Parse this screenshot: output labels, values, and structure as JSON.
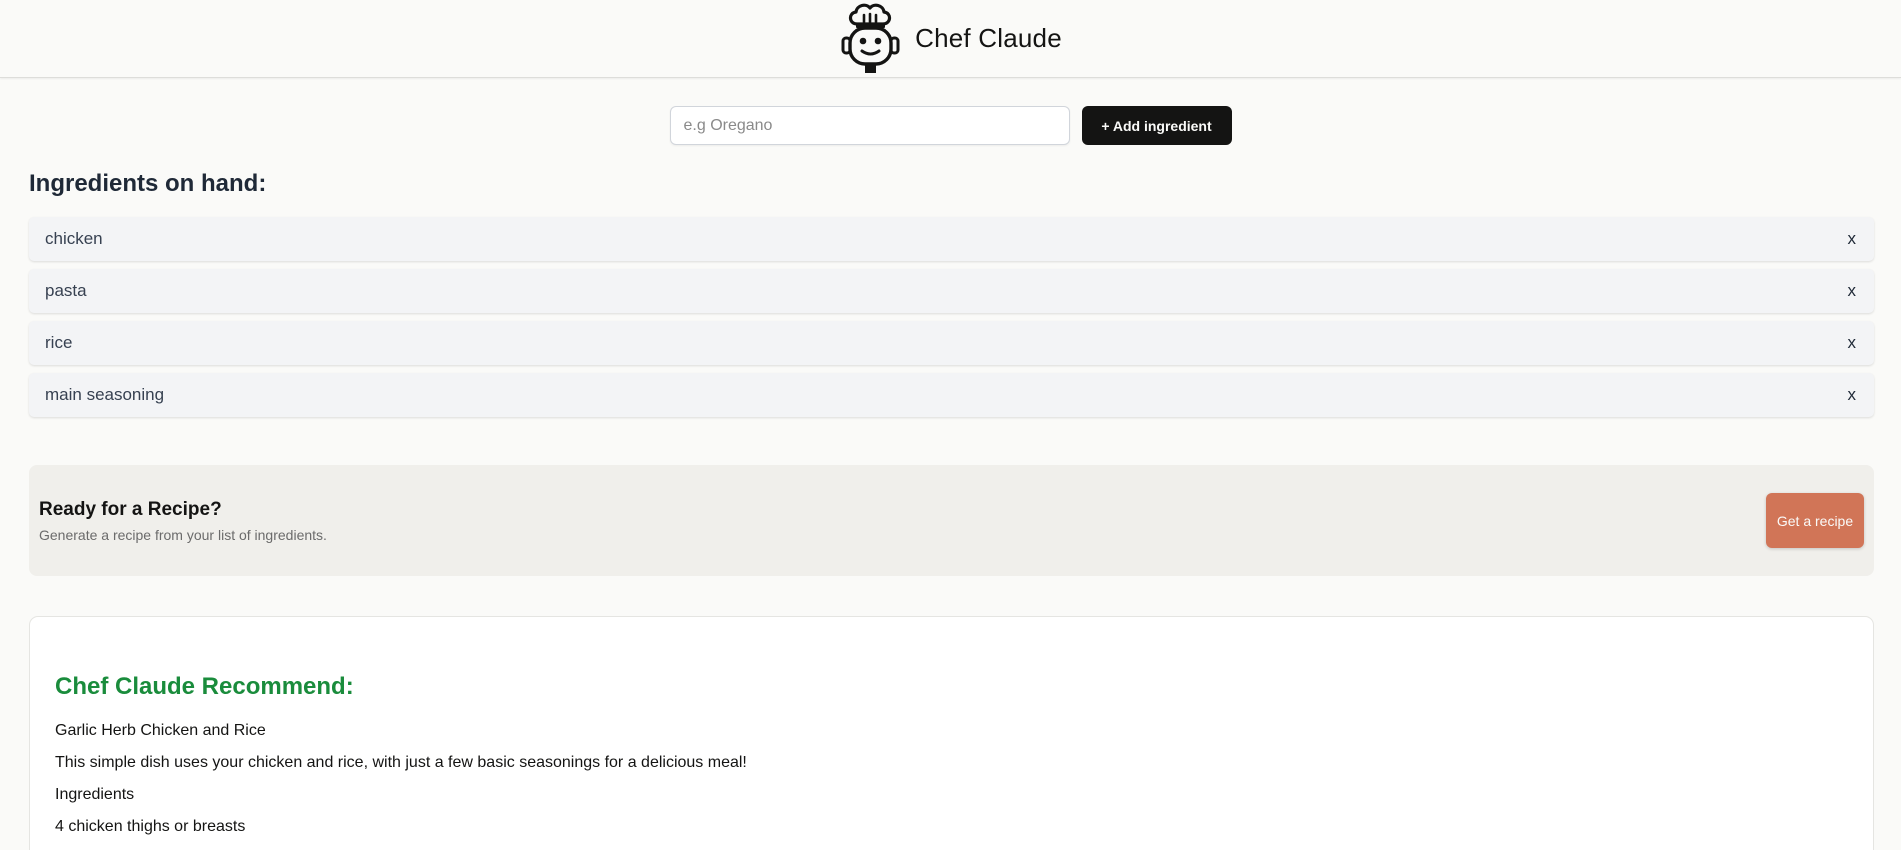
{
  "header": {
    "title": "Chef Claude",
    "logo_icon": "chef-robot-icon"
  },
  "add_form": {
    "placeholder": "e.g Oregano",
    "button_label": "+ Add ingredient"
  },
  "ingredients": {
    "heading": "Ingredients on hand:",
    "items": [
      {
        "name": "chicken",
        "remove_label": "x"
      },
      {
        "name": "pasta",
        "remove_label": "x"
      },
      {
        "name": "rice",
        "remove_label": "x"
      },
      {
        "name": "main seasoning",
        "remove_label": "x"
      }
    ]
  },
  "recipe_cta": {
    "title": "Ready for a Recipe?",
    "subtitle": "Generate a recipe from your list of ingredients.",
    "button_label": "Get a recipe"
  },
  "recommendation": {
    "heading": "Chef Claude Recommend:",
    "lines": [
      "Garlic Herb Chicken and Rice",
      "This simple dish uses your chicken and rice, with just a few basic seasonings for a delicious meal!",
      "Ingredients",
      "4 chicken thighs or breasts"
    ]
  },
  "colors": {
    "background": "#FAFAF8",
    "accent_button": "#D17557",
    "primary_button": "#141413",
    "heading_green": "#1A8C3C"
  }
}
